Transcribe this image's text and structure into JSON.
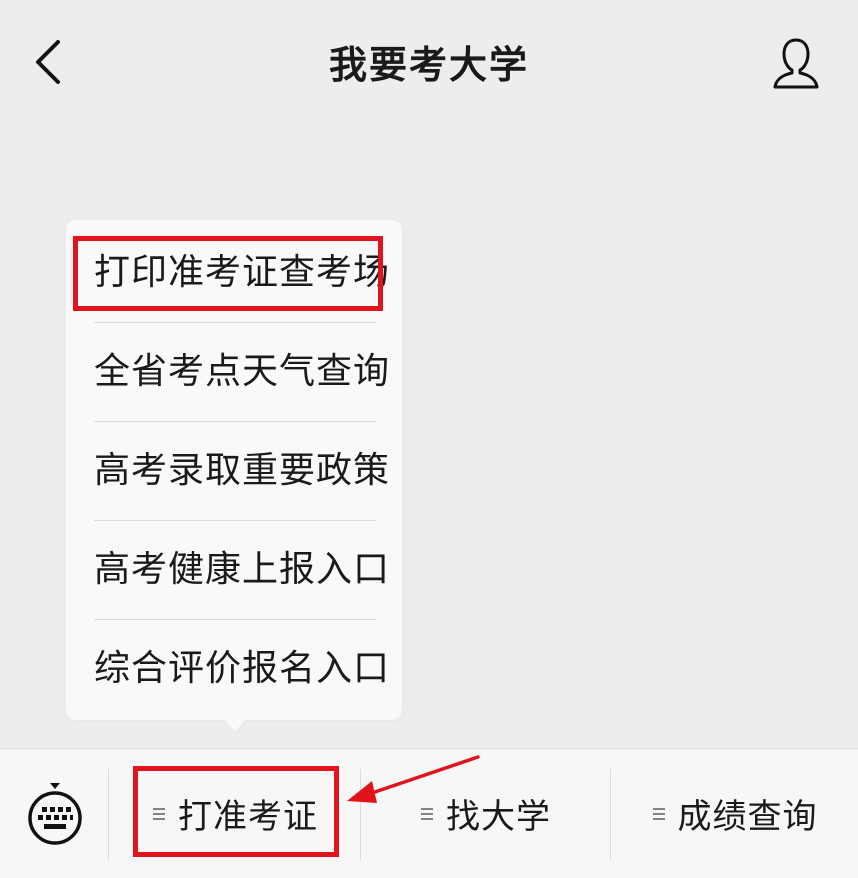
{
  "header": {
    "title": "我要考大学",
    "back_icon": "chevron-left-icon",
    "profile_icon": "user-profile-icon"
  },
  "popup_menu": {
    "items": [
      {
        "label": "打印准考证查考场",
        "highlighted": true
      },
      {
        "label": "全省考点天气查询"
      },
      {
        "label": "高考录取重要政策"
      },
      {
        "label": "高考健康上报入口"
      },
      {
        "label": "综合评价报名入口"
      }
    ]
  },
  "bottom_bar": {
    "keyboard_icon": "keyboard-icon",
    "tabs": [
      {
        "label": "打准考证",
        "highlighted": true
      },
      {
        "label": "找大学"
      },
      {
        "label": "成绩查询"
      }
    ]
  },
  "colors": {
    "background": "#ededed",
    "highlight": "#e1131c",
    "popup": "#f9f9f9",
    "bottom_bar": "#f7f7f7"
  }
}
